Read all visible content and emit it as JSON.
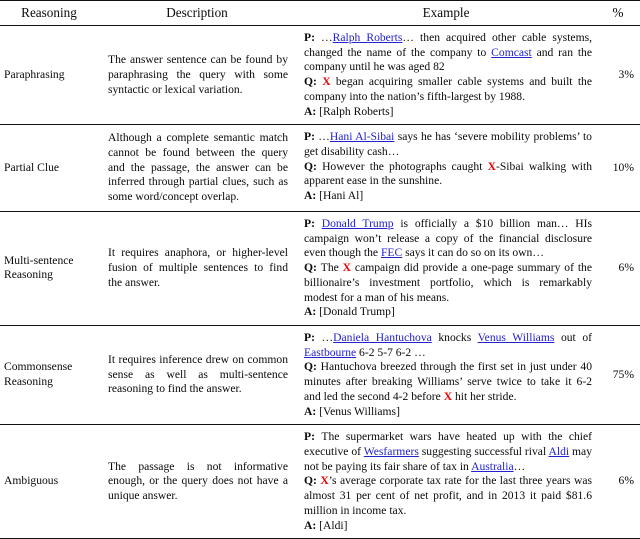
{
  "table": {
    "columns": [
      {
        "key": "reasoning",
        "label": "Reasoning"
      },
      {
        "key": "description",
        "label": "Description"
      },
      {
        "key": "example",
        "label": "Example"
      },
      {
        "key": "percent",
        "label": "%"
      }
    ],
    "colors": {
      "entity_link": "#2222cc",
      "placeholder_x": "#ee0000",
      "rule": "#111111",
      "text": "#0a0a0a"
    },
    "rows": [
      {
        "reasoning": "Paraphrasing",
        "description": "The answer sentence can be found by paraphrasing the query with some syntactic or lexical variation.",
        "percent": "3%",
        "example": {
          "passage_label": "P:",
          "query_label": "Q:",
          "answer_label": "A:",
          "passage_parts": [
            {
              "t": "text",
              "v": "…"
            },
            {
              "t": "entity",
              "v": "Ralph Roberts"
            },
            {
              "t": "text",
              "v": "… then acquired other cable systems, changed the name of the company to "
            },
            {
              "t": "entity",
              "v": "Comcast"
            },
            {
              "t": "text",
              "v": " and ran the company until he was aged 82"
            }
          ],
          "query_parts": [
            {
              "t": "x",
              "v": "X"
            },
            {
              "t": "text",
              "v": " began acquiring smaller cable systems and built the company into the nation’s fifth-largest by 1988."
            }
          ],
          "answer_text": "[Ralph Roberts]"
        }
      },
      {
        "reasoning": "Partial Clue",
        "description": "Although a complete semantic match cannot be found between the query and the passage, the answer can be inferred through partial clues, such as some word/concept overlap.",
        "percent": "10%",
        "example": {
          "passage_label": "P:",
          "query_label": "Q:",
          "answer_label": "A:",
          "passage_parts": [
            {
              "t": "text",
              "v": "…"
            },
            {
              "t": "entity",
              "v": "Hani Al-Sibai"
            },
            {
              "t": "text",
              "v": " says he has ‘severe mobility problems’ to get disability cash…"
            }
          ],
          "query_parts": [
            {
              "t": "text",
              "v": "However the photographs caught "
            },
            {
              "t": "x",
              "v": "X"
            },
            {
              "t": "text",
              "v": "-Sibai walking with apparent ease in the sunshine."
            }
          ],
          "answer_text": "[Hani Al]"
        }
      },
      {
        "reasoning": "Multi-sentence Reasoning",
        "description": "It requires anaphora, or higher-level fusion of multiple sentences to find the answer.",
        "percent": "6%",
        "example": {
          "passage_label": "P:",
          "query_label": "Q:",
          "answer_label": "A:",
          "passage_parts": [
            {
              "t": "entity",
              "v": "Donald Trump"
            },
            {
              "t": "text",
              "v": " is officially a $10 billion man… HIs campaign won’t release a copy of the financial disclosure even though the "
            },
            {
              "t": "entity",
              "v": "FEC"
            },
            {
              "t": "text",
              "v": " says it can do so on its own…"
            }
          ],
          "query_parts": [
            {
              "t": "text",
              "v": "The "
            },
            {
              "t": "x",
              "v": "X"
            },
            {
              "t": "text",
              "v": " campaign did provide a one-page summary of the billionaire’s investment portfolio, which is remarkably modest for a man of his means."
            }
          ],
          "answer_text": "[Donald Trump]"
        }
      },
      {
        "reasoning": "Commonsense Reasoning",
        "description": "It requires inference drew on common sense as well as multi-sentence reasoning to find the answer.",
        "percent": "75%",
        "example": {
          "passage_label": "P:",
          "query_label": "Q:",
          "answer_label": "A:",
          "passage_parts": [
            {
              "t": "text",
              "v": "…"
            },
            {
              "t": "entity",
              "v": "Daniela Hantuchova"
            },
            {
              "t": "text",
              "v": " knocks "
            },
            {
              "t": "entity",
              "v": "Venus Williams"
            },
            {
              "t": "text",
              "v": " out of "
            },
            {
              "t": "entity",
              "v": "Eastbourne"
            },
            {
              "t": "text",
              "v": " 6-2 5-7 6-2 …"
            }
          ],
          "query_parts": [
            {
              "t": "text",
              "v": "Hantuchova breezed through the first set in just under 40 minutes after breaking Williams’ serve twice to take it 6-2 and led the second 4-2 before "
            },
            {
              "t": "x",
              "v": "X"
            },
            {
              "t": "text",
              "v": " hit her stride."
            }
          ],
          "answer_text": "[Venus Williams]"
        }
      },
      {
        "reasoning": "Ambiguous",
        "description": "The passage is not informative enough, or the query does not have a unique answer.",
        "percent": "6%",
        "example": {
          "passage_label": "P:",
          "query_label": "Q:",
          "answer_label": "A:",
          "passage_parts": [
            {
              "t": "text",
              "v": "The supermarket wars have heated up with the chief executive of "
            },
            {
              "t": "entity",
              "v": "Wesfarmers"
            },
            {
              "t": "text",
              "v": " suggesting successful rival "
            },
            {
              "t": "entity",
              "v": "Aldi"
            },
            {
              "t": "text",
              "v": " may not be paying its fair share of tax in "
            },
            {
              "t": "entity",
              "v": "Australia"
            },
            {
              "t": "text",
              "v": "…"
            }
          ],
          "query_parts": [
            {
              "t": "x",
              "v": "X"
            },
            {
              "t": "text",
              "v": "’s average corporate tax rate for the last three years was almost 31 per cent of net profit, and in 2013 it paid $81.6 million in income tax."
            }
          ],
          "answer_text": "[Aldi]"
        }
      }
    ]
  }
}
